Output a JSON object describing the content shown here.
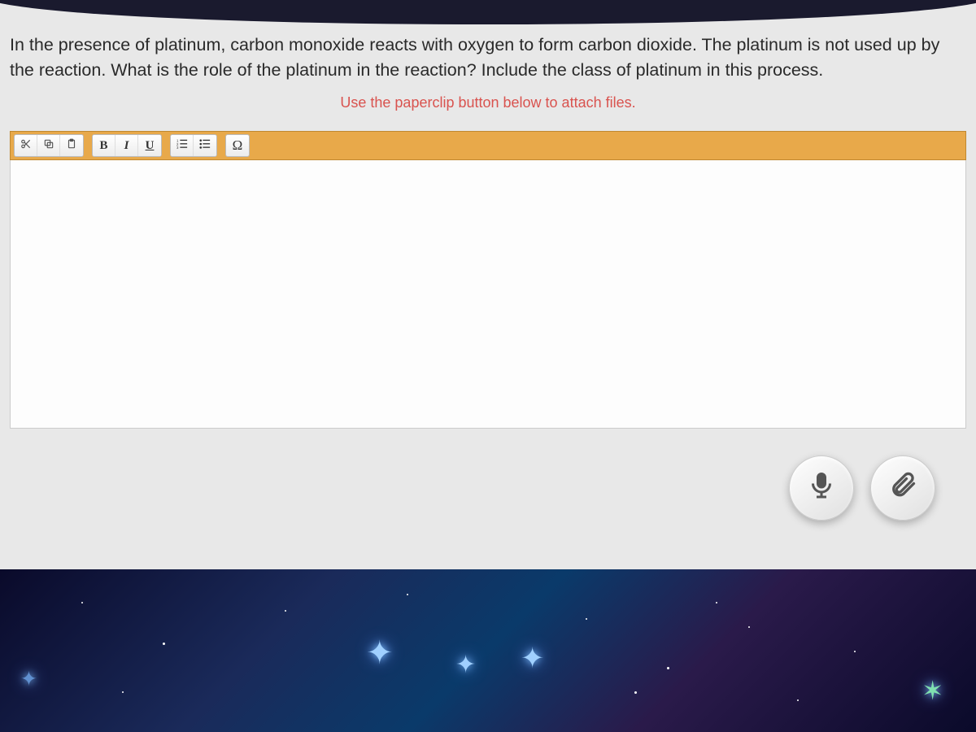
{
  "question": {
    "text": "In the presence of platinum, carbon monoxide reacts with oxygen to form carbon dioxide. The platinum is not used up by the reaction. What is the role of the platinum in the reaction? Include the class of platinum in this process.",
    "hint": "Use the paperclip button below to attach files."
  },
  "toolbar": {
    "cut": "✂",
    "copy": "❐",
    "paste": "📋",
    "bold": "B",
    "italic": "I",
    "underline": "U",
    "ordered": "ol",
    "unordered": "ul",
    "omega": "Ω"
  },
  "editor": {
    "content": ""
  },
  "buttons": {
    "mic": "microphone",
    "attach": "paperclip"
  }
}
